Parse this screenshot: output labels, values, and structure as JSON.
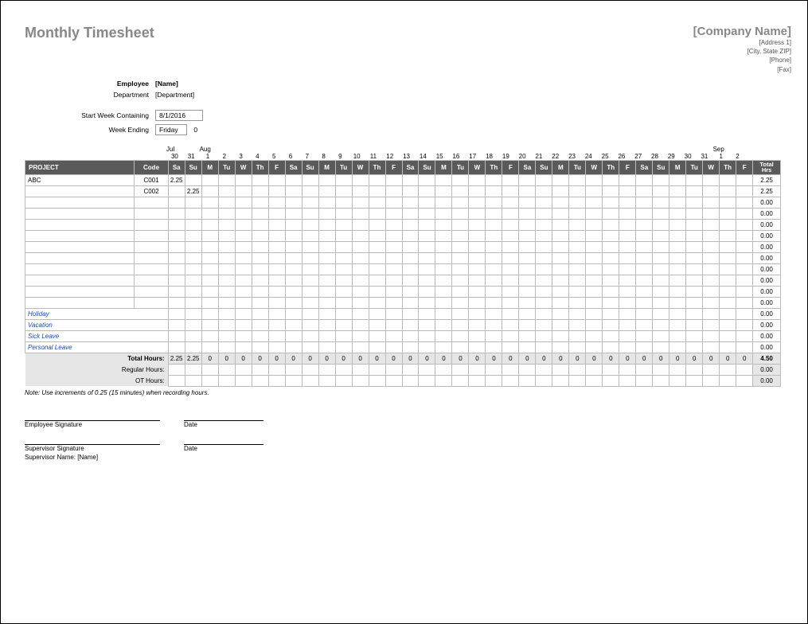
{
  "title": "Monthly Timesheet",
  "company": {
    "name": "[Company Name]",
    "address1": "[Address 1]",
    "city_state_zip": "[City, State ZIP]",
    "phone": "[Phone]",
    "fax": "[Fax]"
  },
  "info": {
    "employee_label": "Employee",
    "employee_value": "[Name]",
    "department_label": "Department",
    "department_value": "[Department]",
    "start_week_label": "Start Week Containing",
    "start_week_value": "8/1/2016",
    "week_ending_label": "Week Ending",
    "week_ending_value": "Friday",
    "week_ending_day": "0"
  },
  "months": {
    "jul": "Jul",
    "aug": "Aug",
    "sep": "Sep"
  },
  "day_numbers": [
    "30",
    "31",
    "1",
    "2",
    "3",
    "4",
    "5",
    "6",
    "7",
    "8",
    "9",
    "10",
    "11",
    "12",
    "13",
    "14",
    "15",
    "16",
    "17",
    "18",
    "19",
    "20",
    "21",
    "22",
    "23",
    "24",
    "25",
    "26",
    "27",
    "28",
    "29",
    "30",
    "31",
    "1",
    "2"
  ],
  "headers": {
    "project": "PROJECT",
    "code": "Code",
    "days": [
      "Sa",
      "Su",
      "M",
      "Tu",
      "W",
      "Th",
      "F",
      "Sa",
      "Su",
      "M",
      "Tu",
      "W",
      "Th",
      "F",
      "Sa",
      "Su",
      "M",
      "Tu",
      "W",
      "Th",
      "F",
      "Sa",
      "Su",
      "M",
      "Tu",
      "W",
      "Th",
      "F",
      "Sa",
      "Su",
      "M",
      "Tu",
      "W",
      "Th",
      "F"
    ],
    "total_hrs": "Total Hrs"
  },
  "rows": [
    {
      "project": "ABC",
      "code": "C001",
      "hours": [
        "2.25",
        "",
        "",
        "",
        "",
        "",
        "",
        "",
        "",
        "",
        "",
        "",
        "",
        "",
        "",
        "",
        "",
        "",
        "",
        "",
        "",
        "",
        "",
        "",
        "",
        "",
        "",
        "",
        "",
        "",
        "",
        "",
        "",
        "",
        ""
      ],
      "total": "2.25"
    },
    {
      "project": "",
      "code": "C002",
      "hours": [
        "",
        "2.25",
        "",
        "",
        "",
        "",
        "",
        "",
        "",
        "",
        "",
        "",
        "",
        "",
        "",
        "",
        "",
        "",
        "",
        "",
        "",
        "",
        "",
        "",
        "",
        "",
        "",
        "",
        "",
        "",
        "",
        "",
        "",
        "",
        ""
      ],
      "total": "2.25"
    },
    {
      "project": "",
      "code": "",
      "hours": [
        "",
        "",
        "",
        "",
        "",
        "",
        "",
        "",
        "",
        "",
        "",
        "",
        "",
        "",
        "",
        "",
        "",
        "",
        "",
        "",
        "",
        "",
        "",
        "",
        "",
        "",
        "",
        "",
        "",
        "",
        "",
        "",
        "",
        "",
        ""
      ],
      "total": "0.00"
    },
    {
      "project": "",
      "code": "",
      "hours": [
        "",
        "",
        "",
        "",
        "",
        "",
        "",
        "",
        "",
        "",
        "",
        "",
        "",
        "",
        "",
        "",
        "",
        "",
        "",
        "",
        "",
        "",
        "",
        "",
        "",
        "",
        "",
        "",
        "",
        "",
        "",
        "",
        "",
        "",
        ""
      ],
      "total": "0.00"
    },
    {
      "project": "",
      "code": "",
      "hours": [
        "",
        "",
        "",
        "",
        "",
        "",
        "",
        "",
        "",
        "",
        "",
        "",
        "",
        "",
        "",
        "",
        "",
        "",
        "",
        "",
        "",
        "",
        "",
        "",
        "",
        "",
        "",
        "",
        "",
        "",
        "",
        "",
        "",
        "",
        ""
      ],
      "total": "0.00"
    },
    {
      "project": "",
      "code": "",
      "hours": [
        "",
        "",
        "",
        "",
        "",
        "",
        "",
        "",
        "",
        "",
        "",
        "",
        "",
        "",
        "",
        "",
        "",
        "",
        "",
        "",
        "",
        "",
        "",
        "",
        "",
        "",
        "",
        "",
        "",
        "",
        "",
        "",
        "",
        "",
        ""
      ],
      "total": "0.00"
    },
    {
      "project": "",
      "code": "",
      "hours": [
        "",
        "",
        "",
        "",
        "",
        "",
        "",
        "",
        "",
        "",
        "",
        "",
        "",
        "",
        "",
        "",
        "",
        "",
        "",
        "",
        "",
        "",
        "",
        "",
        "",
        "",
        "",
        "",
        "",
        "",
        "",
        "",
        "",
        "",
        ""
      ],
      "total": "0.00"
    },
    {
      "project": "",
      "code": "",
      "hours": [
        "",
        "",
        "",
        "",
        "",
        "",
        "",
        "",
        "",
        "",
        "",
        "",
        "",
        "",
        "",
        "",
        "",
        "",
        "",
        "",
        "",
        "",
        "",
        "",
        "",
        "",
        "",
        "",
        "",
        "",
        "",
        "",
        "",
        "",
        ""
      ],
      "total": "0.00"
    },
    {
      "project": "",
      "code": "",
      "hours": [
        "",
        "",
        "",
        "",
        "",
        "",
        "",
        "",
        "",
        "",
        "",
        "",
        "",
        "",
        "",
        "",
        "",
        "",
        "",
        "",
        "",
        "",
        "",
        "",
        "",
        "",
        "",
        "",
        "",
        "",
        "",
        "",
        "",
        "",
        ""
      ],
      "total": "0.00"
    },
    {
      "project": "",
      "code": "",
      "hours": [
        "",
        "",
        "",
        "",
        "",
        "",
        "",
        "",
        "",
        "",
        "",
        "",
        "",
        "",
        "",
        "",
        "",
        "",
        "",
        "",
        "",
        "",
        "",
        "",
        "",
        "",
        "",
        "",
        "",
        "",
        "",
        "",
        "",
        "",
        ""
      ],
      "total": "0.00"
    },
    {
      "project": "",
      "code": "",
      "hours": [
        "",
        "",
        "",
        "",
        "",
        "",
        "",
        "",
        "",
        "",
        "",
        "",
        "",
        "",
        "",
        "",
        "",
        "",
        "",
        "",
        "",
        "",
        "",
        "",
        "",
        "",
        "",
        "",
        "",
        "",
        "",
        "",
        "",
        "",
        ""
      ],
      "total": "0.00"
    },
    {
      "project": "",
      "code": "",
      "hours": [
        "",
        "",
        "",
        "",
        "",
        "",
        "",
        "",
        "",
        "",
        "",
        "",
        "",
        "",
        "",
        "",
        "",
        "",
        "",
        "",
        "",
        "",
        "",
        "",
        "",
        "",
        "",
        "",
        "",
        "",
        "",
        "",
        "",
        "",
        ""
      ],
      "total": "0.00"
    }
  ],
  "leave_rows": [
    {
      "label": "Holiday",
      "total": "0.00"
    },
    {
      "label": "Vacation",
      "total": "0.00"
    },
    {
      "label": "Sick Leave",
      "total": "0.00"
    },
    {
      "label": "Personal Leave",
      "total": "0.00"
    }
  ],
  "summary": {
    "total_hours_label": "Total Hours:",
    "total_hours_values": [
      "2.25",
      "2.25",
      "0",
      "0",
      "0",
      "0",
      "0",
      "0",
      "0",
      "0",
      "0",
      "0",
      "0",
      "0",
      "0",
      "0",
      "0",
      "0",
      "0",
      "0",
      "0",
      "0",
      "0",
      "0",
      "0",
      "0",
      "0",
      "0",
      "0",
      "0",
      "0",
      "0",
      "0",
      "0",
      "0"
    ],
    "total_hours_total": "4.50",
    "regular_hours_label": "Regular Hours:",
    "regular_hours_total": "0.00",
    "ot_hours_label": "OT Hours:",
    "ot_hours_total": "0.00"
  },
  "note": "Note: Use increments of 0.25 (15 minutes) when recording hours.",
  "signatures": {
    "employee_sig": "Employee Signature",
    "supervisor_sig": "Supervisor Signature",
    "date": "Date",
    "supervisor_name_label": "Supervisor Name:",
    "supervisor_name_value": "[Name]"
  }
}
